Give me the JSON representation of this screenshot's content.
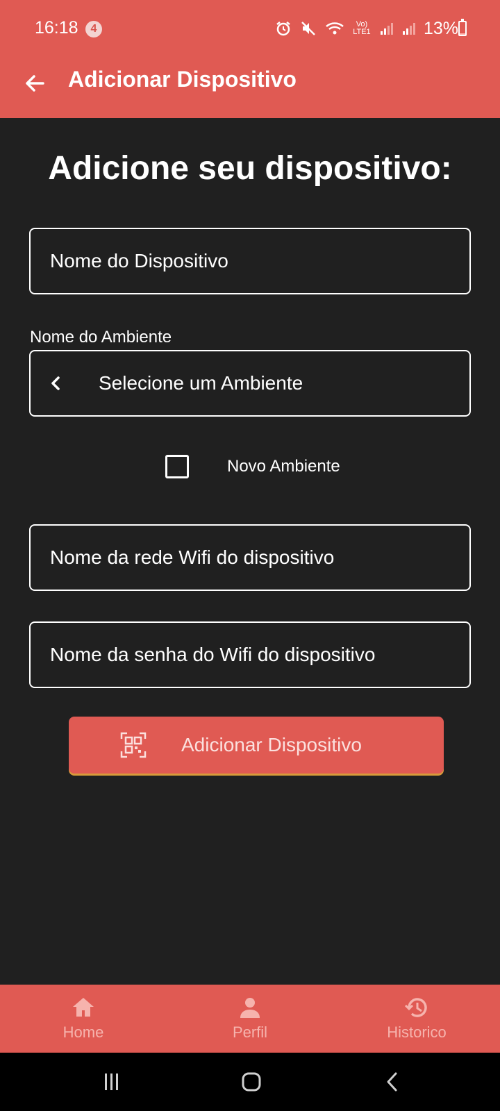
{
  "status_bar": {
    "time": "16:18",
    "notification_count": "4",
    "battery": "13%",
    "network_label": "Vo) LTE1"
  },
  "app_bar": {
    "title": "Adicionar Dispositivo"
  },
  "main": {
    "heading": "Adicione seu dispositivo:",
    "device_name_placeholder": "Nome do Dispositivo",
    "environment_label": "Nome do Ambiente",
    "environment_select_value": "Selecione um Ambiente",
    "new_environment_label": "Novo Ambiente",
    "new_environment_checked": false,
    "wifi_name_placeholder": "Nome da rede Wifi do dispositivo",
    "wifi_password_placeholder": "Nome da senha do Wifi do dispositivo",
    "submit_button_label": "Adicionar Dispositivo"
  },
  "bottom_nav": {
    "items": [
      {
        "label": "Home",
        "icon": "home-icon"
      },
      {
        "label": "Perfil",
        "icon": "person-icon"
      },
      {
        "label": "Historico",
        "icon": "history-icon"
      }
    ]
  },
  "colors": {
    "accent": "#e05a53",
    "background": "#202020",
    "nav_label": "#f6b3ad"
  }
}
